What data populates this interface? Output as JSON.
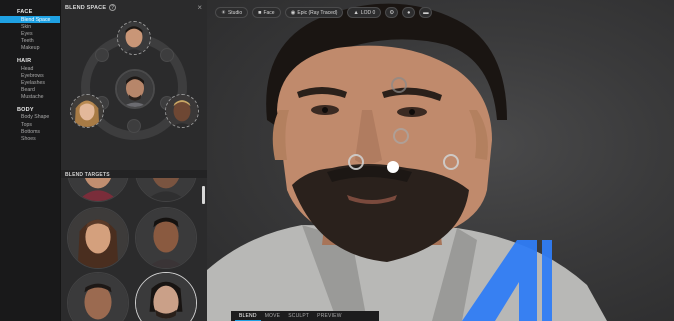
{
  "sidebar": {
    "sections": [
      {
        "title": "FACE",
        "items": [
          {
            "label": "Blend Space",
            "active": true
          },
          {
            "label": "Skin"
          },
          {
            "label": "Eyes"
          },
          {
            "label": "Teeth"
          },
          {
            "label": "Makeup"
          }
        ]
      },
      {
        "title": "HAIR",
        "items": [
          {
            "label": "Head"
          },
          {
            "label": "Eyebrows"
          },
          {
            "label": "Eyelashes"
          },
          {
            "label": "Beard"
          },
          {
            "label": "Mustache"
          }
        ]
      },
      {
        "title": "BODY",
        "items": [
          {
            "label": "Body Shape"
          },
          {
            "label": "Tops"
          },
          {
            "label": "Bottoms"
          },
          {
            "label": "Shoes"
          }
        ]
      }
    ]
  },
  "blend_panel": {
    "title": "BLEND SPACE",
    "help_icon": "?",
    "close_icon": "×",
    "targets_title": "BLEND TARGETS"
  },
  "toolbar": {
    "studio": "Studio",
    "face": "Face",
    "quality": "Epic (Ray Traced)",
    "lod": "LOD 0"
  },
  "bottom_tabs": {
    "items": [
      {
        "label": "BLEND",
        "active": true
      },
      {
        "label": "MOVE"
      },
      {
        "label": "SCULPT"
      },
      {
        "label": "PREVIEW"
      }
    ]
  },
  "colors": {
    "accent": "#1fa1e3",
    "logo": "#2f7cf6"
  }
}
